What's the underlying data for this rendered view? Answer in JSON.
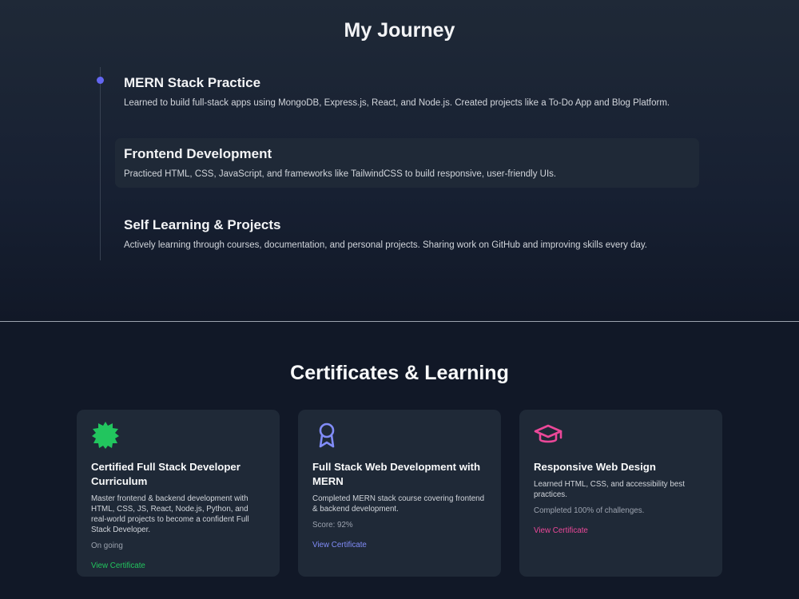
{
  "journey": {
    "title": "My Journey",
    "items": [
      {
        "title": "MERN Stack Practice",
        "description": "Learned to build full-stack apps using MongoDB, Express.js, React, and Node.js. Created projects like a To-Do App and Blog Platform."
      },
      {
        "title": "Frontend Development",
        "description": "Practiced HTML, CSS, JavaScript, and frameworks like TailwindCSS to build responsive, user-friendly UIs."
      },
      {
        "title": "Self Learning & Projects",
        "description": "Actively learning through courses, documentation, and personal projects. Sharing work on GitHub and improving skills every day."
      }
    ]
  },
  "certificates": {
    "title": "Certificates & Learning",
    "cards": [
      {
        "icon": "badge-icon",
        "accent": "#22c55e",
        "title": "Certified Full Stack Developer Curriculum",
        "description": "Master frontend & backend development with HTML, CSS, JS, React, Node.js, Python, and real-world projects to become a confident Full Stack Developer.",
        "status": "On going",
        "link": "View Certificate"
      },
      {
        "icon": "award-ribbon-icon",
        "accent": "#818cf8",
        "title": "Full Stack Web Development with MERN",
        "description": "Completed MERN stack course covering frontend & backend development.",
        "status": "Score: 92%",
        "link": "View Certificate"
      },
      {
        "icon": "graduation-cap-icon",
        "accent": "#ec4899",
        "title": "Responsive Web Design",
        "description": "Learned HTML, CSS, and accessibility best practices.",
        "status": "Completed 100% of challenges.",
        "link": "View Certificate"
      }
    ]
  }
}
